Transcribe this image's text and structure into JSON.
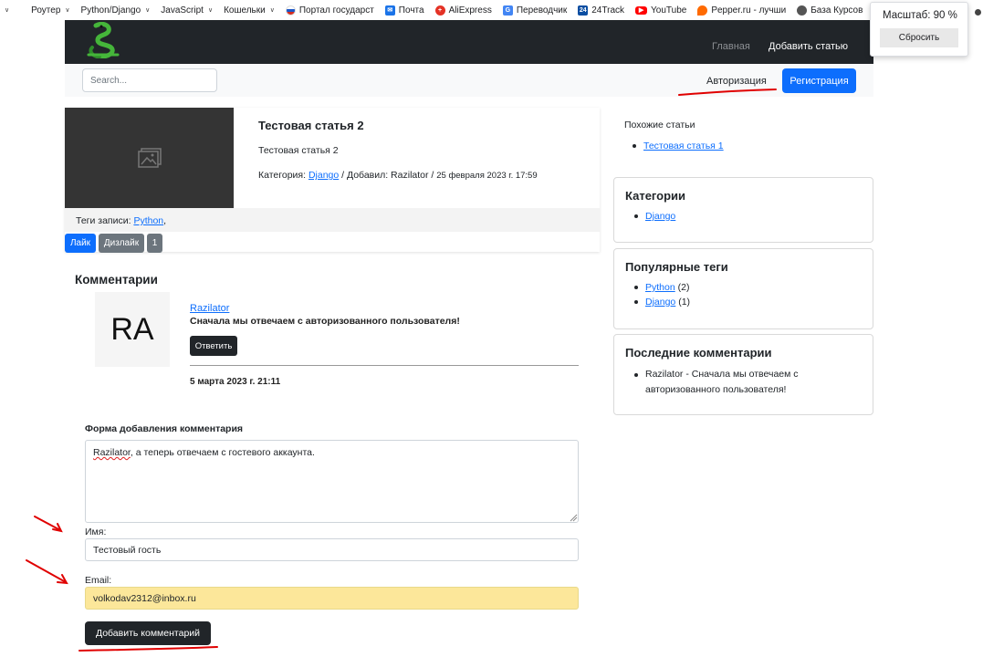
{
  "bookmarks": [
    {
      "label": "",
      "chevron": true
    },
    {
      "label": "Роутер",
      "chevron": true
    },
    {
      "label": "Python/Django",
      "chevron": true
    },
    {
      "label": "JavaScript",
      "chevron": true
    },
    {
      "label": "Кошельки",
      "chevron": true
    },
    {
      "label": "Портал государст",
      "icon": "russia-flag-icon"
    },
    {
      "label": "Почта",
      "icon": "mail-icon"
    },
    {
      "label": "AliExpress",
      "icon": "aliexpress-icon"
    },
    {
      "label": "Переводчик",
      "icon": "translate-icon"
    },
    {
      "label": "24Track",
      "icon": "24track-icon"
    },
    {
      "label": "YouTube",
      "icon": "youtube-icon"
    },
    {
      "label": "Pepper.ru - лучши",
      "icon": "pepper-icon"
    },
    {
      "label": "База Курсов",
      "icon": "baza-icon"
    }
  ],
  "zoom": {
    "label": "Масштаб: 90 %",
    "reset": "Сбросить"
  },
  "navbar": {
    "home": "Главная",
    "add_article": "Добавить статью"
  },
  "subbar": {
    "search_placeholder": "Search...",
    "auth": "Авторизация",
    "register": "Регистрация"
  },
  "article": {
    "title": "Тестовая статья 2",
    "text": "Тестовая статья 2",
    "meta_category_label": "Категория:",
    "category": "Django",
    "meta_added": "/ Добавил: Razilator /",
    "date": "25 февраля 2023 г. 17:59",
    "tags_label": "Теги записи:",
    "tag": "Python",
    "tag_sep": ",",
    "like": "Лайк",
    "dislike": "Дизлайк",
    "count": "1"
  },
  "comments": {
    "title": "Комментарии",
    "items": [
      {
        "avatar": "RA",
        "author": "Razilator",
        "text": "Сначала мы отвечаем с авторизованного пользователя!",
        "reply": "Ответить",
        "date": "5 марта 2023 г. 21:11"
      }
    ]
  },
  "form": {
    "title": "Форма добавления комментария",
    "textarea_mention": "Razilator",
    "textarea_rest": ", а теперь отвечаем с гостевого аккаунта.",
    "name_label": "Имя:",
    "name_value": "Тестовый гость",
    "email_label": "Email:",
    "email_value": "volkodav2312@inbox.ru",
    "submit": "Добавить комментарий"
  },
  "sidebar": {
    "similar_title": "Похожие статьи",
    "similar": [
      "Тестовая статья 1"
    ],
    "categories_title": "Категории",
    "categories": [
      "Django"
    ],
    "tags_title": "Популярные теги",
    "tags": [
      {
        "name": "Python",
        "count": "(2)"
      },
      {
        "name": "Django",
        "count": "(1)"
      }
    ],
    "last_title": "Последние комментарии",
    "last_comment": "Razilator - Сначала мы отвечаем с авторизованного пользователя!"
  },
  "colors": {
    "primary": "#0d6efd",
    "dark": "#212529",
    "secondary": "#6c757d",
    "annotation": "#e00000",
    "autofill": "#fce79a"
  }
}
